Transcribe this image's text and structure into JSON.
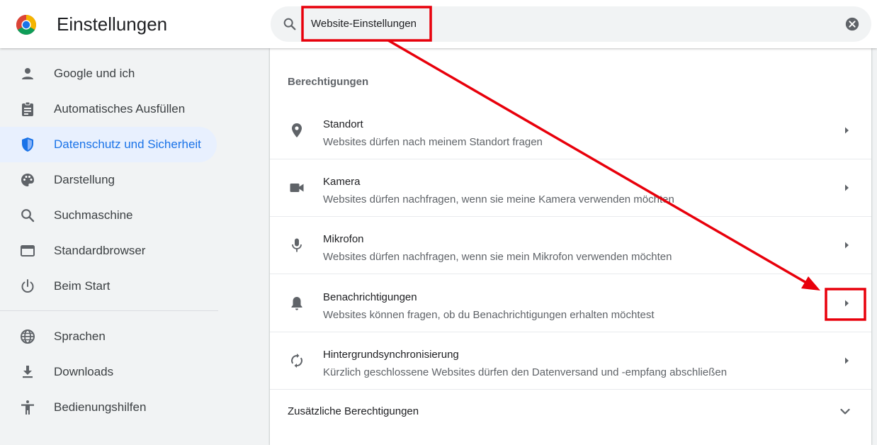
{
  "header": {
    "title": "Einstellungen",
    "search_value": "Website-Einstellungen"
  },
  "sidebar": {
    "items": [
      {
        "label": "Google und ich",
        "icon": "person-icon",
        "active": false
      },
      {
        "label": "Automatisches Ausfüllen",
        "icon": "clipboard-icon",
        "active": false
      },
      {
        "label": "Datenschutz und Sicherheit",
        "icon": "shield-icon",
        "active": true
      },
      {
        "label": "Darstellung",
        "icon": "palette-icon",
        "active": false
      },
      {
        "label": "Suchmaschine",
        "icon": "search-icon",
        "active": false
      },
      {
        "label": "Standardbrowser",
        "icon": "browser-window-icon",
        "active": false
      },
      {
        "label": "Beim Start",
        "icon": "power-icon",
        "active": false
      },
      {
        "label": "Sprachen",
        "icon": "globe-icon",
        "active": false
      },
      {
        "label": "Downloads",
        "icon": "download-icon",
        "active": false
      },
      {
        "label": "Bedienungshilfen",
        "icon": "accessibility-icon",
        "active": false
      }
    ]
  },
  "main": {
    "section_title": "Berechtigungen",
    "permissions": [
      {
        "title": "Standort",
        "subtitle": "Websites dürfen nach meinem Standort fragen",
        "icon": "location-pin-icon"
      },
      {
        "title": "Kamera",
        "subtitle": "Websites dürfen nachfragen, wenn sie meine Kamera verwenden möchten",
        "icon": "camera-icon"
      },
      {
        "title": "Mikrofon",
        "subtitle": "Websites dürfen nachfragen, wenn sie mein Mikrofon verwenden möchten",
        "icon": "microphone-icon"
      },
      {
        "title": "Benachrichtigungen",
        "subtitle": "Websites können fragen, ob du Benachrichtigungen erhalten möchtest",
        "icon": "bell-icon"
      },
      {
        "title": "Hintergrundsynchronisierung",
        "subtitle": "Kürzlich geschlossene Websites dürfen den Datenversand und -empfang abschließen",
        "icon": "sync-icon"
      }
    ],
    "more_label": "Zusätzliche Berechtigungen"
  },
  "colors": {
    "accent": "#1a73e8",
    "active_bg": "#e8f0fe",
    "annotation": "#e8000b"
  }
}
